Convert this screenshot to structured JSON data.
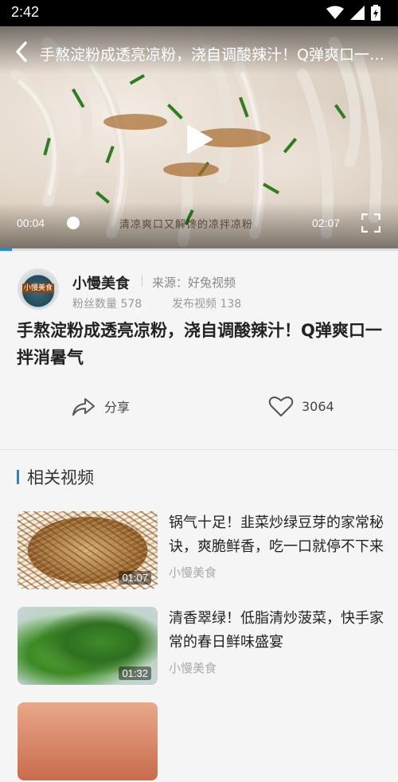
{
  "status": {
    "time": "2:42"
  },
  "video": {
    "title": "手熬淀粉成透亮凉粉，浇自调酸辣汁！Q弹爽口一拌消暑气",
    "subtitle": "清凉爽口又解馋的凉拌凉粉",
    "current_time": "00:04",
    "total_time": "02:07",
    "progress_fraction": 0.03
  },
  "author": {
    "name": "小慢美食",
    "avatar_text": "小慢美食",
    "source": "来源：好兔视频",
    "fans": "粉丝数量 578",
    "posts": "发布视频 138"
  },
  "detail": {
    "title": "手熬淀粉成透亮凉粉，浇自调酸辣汁！Q弹爽口一拌消暑气",
    "share_label": "分享",
    "like_count": "3064"
  },
  "related": {
    "heading": "相关视频",
    "items": [
      {
        "title": "锅气十足！韭菜炒绿豆芽的家常秘诀，爽脆鲜香，吃一口就停不下来",
        "author": "小慢美食",
        "duration": "01:07"
      },
      {
        "title": "清香翠绿！低脂清炒菠菜，快手家常的春日鲜味盛宴",
        "author": "小慢美食",
        "duration": "01:32"
      }
    ]
  },
  "colors": {
    "accent": "#1e88e5"
  }
}
